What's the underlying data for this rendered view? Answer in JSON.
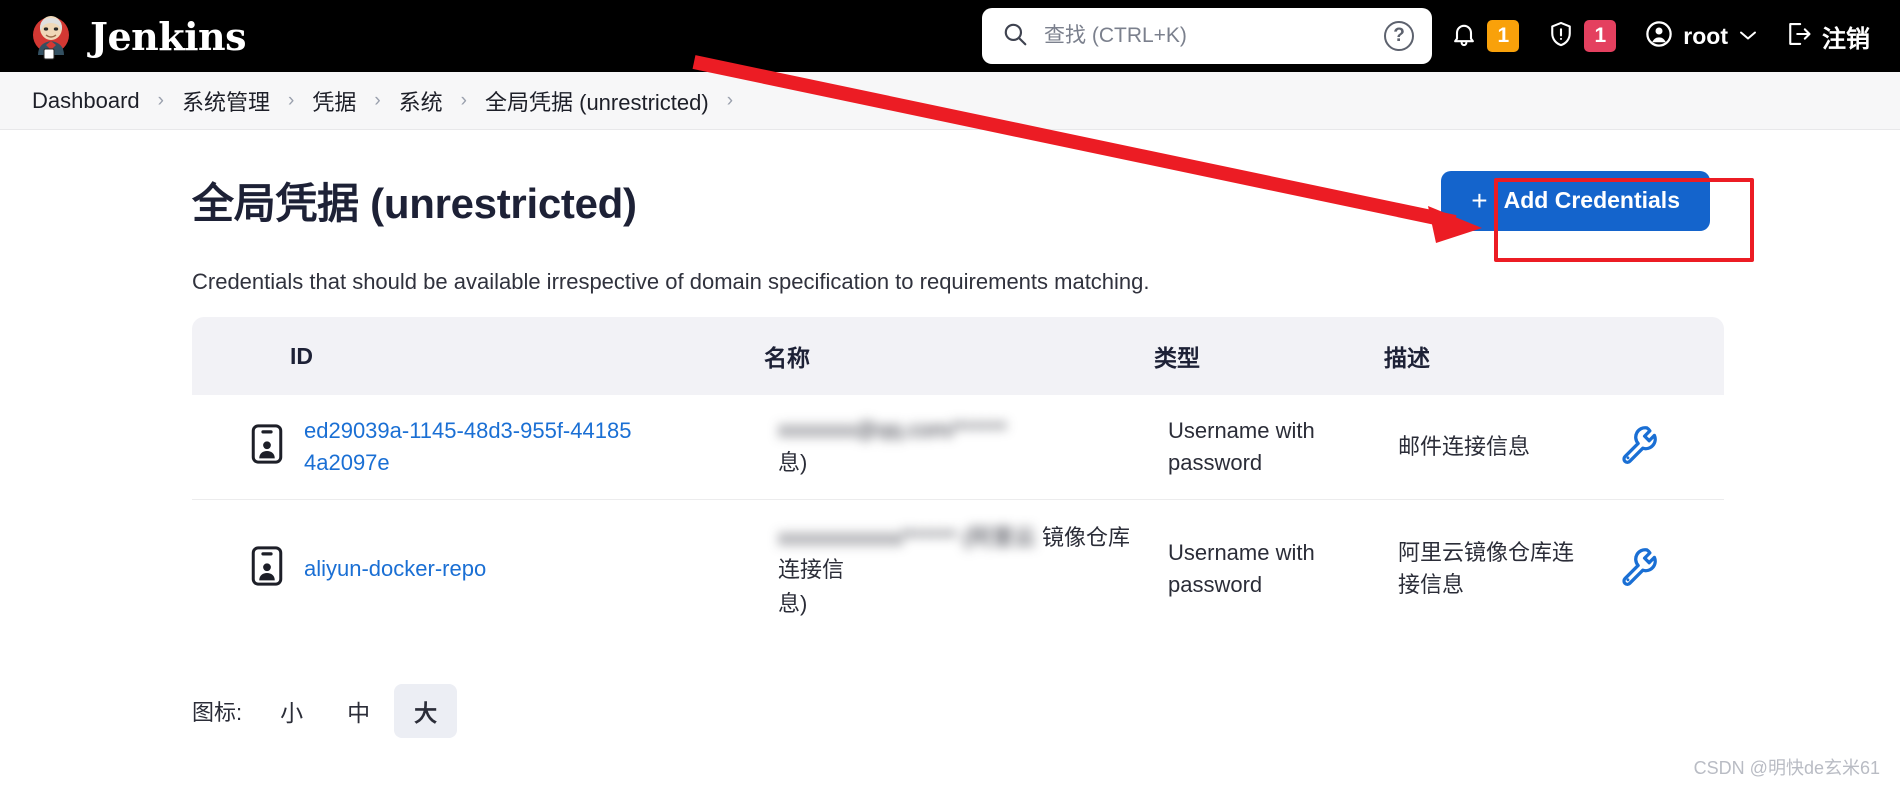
{
  "header": {
    "brand": "Jenkins",
    "brand_logo_icon": "jenkins-butler-logo",
    "search": {
      "placeholder": "查找 (CTRL+K)",
      "value": "",
      "search_icon": "search-icon",
      "help_icon": "help-circle-icon"
    },
    "notifications": {
      "icon": "bell-icon",
      "count": "1",
      "color": "#f9a10a"
    },
    "security": {
      "icon": "shield-warning-icon",
      "count": "1",
      "color": "#e4405f"
    },
    "user": {
      "icon": "user-circle-icon",
      "name": "root",
      "chevron_icon": "chevron-down-icon"
    },
    "logout": {
      "icon": "logout-icon",
      "label": "注销"
    }
  },
  "breadcrumb": {
    "items": [
      {
        "label": "Dashboard"
      },
      {
        "label": "系统管理"
      },
      {
        "label": "凭据"
      },
      {
        "label": "系统"
      },
      {
        "label": "全局凭据 (unrestricted)"
      }
    ],
    "separator": "›"
  },
  "main": {
    "title": "全局凭据 (unrestricted)",
    "add_button": {
      "label": "Add Credentials",
      "plus_icon": "plus-icon",
      "color": "#1464cc"
    },
    "description": "Credentials that should be available irrespective of domain specification to requirements matching.",
    "table": {
      "headers": [
        "ID",
        "名称",
        "类型",
        "描述"
      ],
      "rows": [
        {
          "icon": "credential-id-card-icon",
          "id": "ed29039a-1145-48d3-955f-441854a2097e",
          "name_blurred": "xxxxxxx@qq.com/******",
          "name_tail": "息)",
          "type": "Username with password",
          "description": "邮件连接信息",
          "action_icon": "wrench-icon"
        },
        {
          "icon": "credential-id-card-icon",
          "id": "aliyun-docker-repo",
          "name_blurred": "xxxxxxxxxxx/****** (阿里云",
          "name_tail": "息)",
          "name_visible_tail": "镜像仓库连接信",
          "type": "Username with password",
          "description": "阿里云镜像仓库连接信息",
          "action_icon": "wrench-icon"
        }
      ]
    },
    "icon_size": {
      "label": "图标:",
      "options": [
        {
          "label": "小",
          "selected": false
        },
        {
          "label": "中",
          "selected": false
        },
        {
          "label": "大",
          "selected": true
        }
      ]
    }
  },
  "annotations": {
    "arrow_color": "#ec1c24",
    "box_color": "#ec1c24"
  },
  "watermark": "CSDN @明快de玄米61"
}
